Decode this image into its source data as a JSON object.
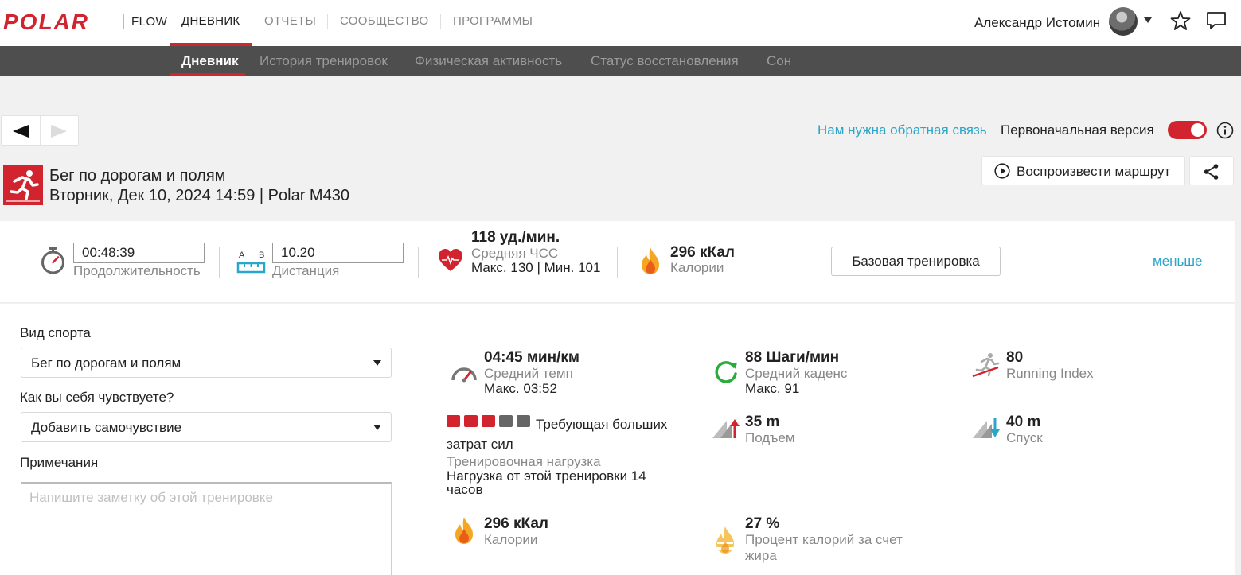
{
  "brand": {
    "logo_text": "POLAR",
    "product": "FLOW"
  },
  "top_menu": [
    {
      "label": "ДНЕВНИК",
      "active": true
    },
    {
      "label": "ОТЧЕТЫ",
      "active": false
    },
    {
      "label": "СООБЩЕСТВО",
      "active": false
    },
    {
      "label": "ПРОГРАММЫ",
      "active": false
    }
  ],
  "user": {
    "name": "Александр Истомин"
  },
  "sub_menu": [
    {
      "label": "Дневник",
      "active": true
    },
    {
      "label": "История тренировок",
      "active": false
    },
    {
      "label": "Физическая активность",
      "active": false
    },
    {
      "label": "Статус восстановления",
      "active": false
    },
    {
      "label": "Сон",
      "active": false
    }
  ],
  "toolbar": {
    "feedback_link": "Нам нужна обратная связь",
    "original_version_label": "Первоначальная версия",
    "original_version_on": true
  },
  "session": {
    "title": "Бег по дорогам и полям",
    "subtitle": "Вторник, Дек 10, 2024 14:59 | Polar M430",
    "replay_label": "Воспроизвести маршрут"
  },
  "summary": {
    "duration": {
      "value": "00:48:39",
      "label": "Продолжительность"
    },
    "distance": {
      "value": "10.20",
      "label": "Дистанция",
      "icon_letters": [
        "A",
        "B"
      ]
    },
    "heart_rate": {
      "value": "118 уд./мин.",
      "label": "Средняя ЧСС",
      "minmax": "Макс. 130  |  Мин. 101"
    },
    "calories": {
      "value": "296 кКал",
      "label": "Калории"
    },
    "base_button": "Базовая тренировка",
    "less_link": "меньше"
  },
  "form": {
    "sport_label": "Вид спорта",
    "sport_value": "Бег по дорогам и полям",
    "feeling_label": "Как вы себя чувствуете?",
    "feeling_value": "Добавить самочувствие",
    "notes_label": "Примечания",
    "notes_placeholder": "Напишите заметку об этой тренировке"
  },
  "metrics": {
    "pace": {
      "value": "04:45 мин/км",
      "label": "Средний темп",
      "sub": "Макс. 03:52"
    },
    "cadence": {
      "value": "88 Шаги/мин",
      "label": "Средний каденс",
      "sub": "Макс. 91"
    },
    "running_index": {
      "value": "80",
      "label": "Running Index"
    },
    "training_load": {
      "level": 3,
      "level_max": 5,
      "text": "Требующая больших затрат сил",
      "label": "Тренировочная нагрузка",
      "sub": "Нагрузка от этой тренировки 14 часов"
    },
    "ascent": {
      "value": "35 m",
      "label": "Подъем"
    },
    "descent": {
      "value": "40 m",
      "label": "Спуск"
    },
    "calories": {
      "value": "296 кКал",
      "label": "Калории"
    },
    "fat_percent": {
      "value": "27 %",
      "label": "Процент калорий за счет жира"
    }
  },
  "colors": {
    "accent": "#d1242f",
    "link": "#2ba5c8",
    "muted": "#888888",
    "subnav_bg": "#4e4e4e",
    "load_inactive": "#666666"
  },
  "icons": [
    "stopwatch-icon",
    "distance-ab-icon",
    "heart-icon",
    "flame-icon",
    "speedometer-icon",
    "cadence-icon",
    "running-index-icon",
    "ascent-icon",
    "descent-icon",
    "fat-flame-icon",
    "star-icon",
    "chat-icon",
    "info-icon",
    "play-icon",
    "share-icon",
    "runner-icon"
  ]
}
